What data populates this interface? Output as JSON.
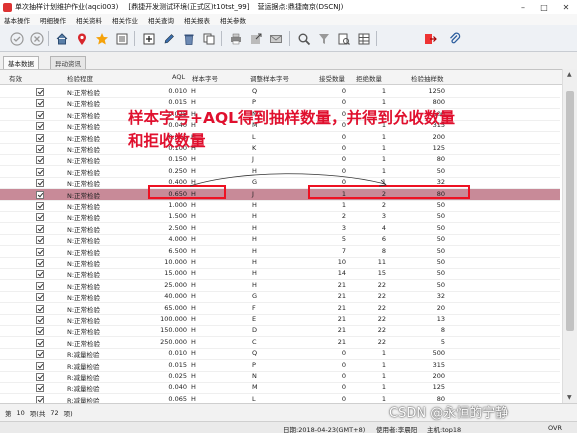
{
  "window": {
    "title": "单次抽样计划维护作业(aqci003)",
    "env": "[鼎捷开发测试环境(正式区)t10tst_99]",
    "site": "营运据点:鼎捷南京(DSCNJ)"
  },
  "menu": [
    "基本操作",
    "明细操作",
    "相关资料",
    "相关作业",
    "相关查询",
    "相关报表",
    "相关参数"
  ],
  "toolbar": {
    "icons": [
      "confirm-icon",
      "cancel-icon",
      "home-icon",
      "location-pin-icon",
      "star-icon",
      "list-icon",
      "add-icon",
      "edit-icon",
      "delete-icon",
      "copy-icon",
      "print-icon",
      "export-icon",
      "mail-icon",
      "search-icon",
      "filter-icon",
      "query-icon",
      "table-icon",
      "exit-icon",
      "attach-icon"
    ]
  },
  "tabs": [
    "基本数据",
    "异动资讯"
  ],
  "columns": {
    "valid": "有效",
    "level": "检验程度",
    "aql": "AQL",
    "sample_code": "样本字号",
    "adj_code": "调整样本字号",
    "accept": "接受数量",
    "reject": "拒绝数量",
    "sample_qty": "检验抽样数"
  },
  "rows": [
    {
      "level": "N:正常检验",
      "aql": "0.010",
      "c": "H",
      "adj": "Q",
      "acc": "0",
      "rej": "1",
      "qty": "1250"
    },
    {
      "level": "N:正常检验",
      "aql": "0.015",
      "c": "H",
      "adj": "P",
      "acc": "0",
      "rej": "1",
      "qty": "800"
    },
    {
      "level": "N:正常检验",
      "aql": "0.025",
      "c": "H",
      "adj": "N",
      "acc": "0",
      "rej": "1",
      "qty": "500"
    },
    {
      "level": "N:正常检验",
      "aql": "0.040",
      "c": "H",
      "adj": "M",
      "acc": "0",
      "rej": "1",
      "qty": "315"
    },
    {
      "level": "N:正常检验",
      "aql": "0.065",
      "c": "H",
      "adj": "L",
      "acc": "0",
      "rej": "1",
      "qty": "200"
    },
    {
      "level": "N:正常检验",
      "aql": "0.100",
      "c": "H",
      "adj": "K",
      "acc": "0",
      "rej": "1",
      "qty": "125"
    },
    {
      "level": "N:正常检验",
      "aql": "0.150",
      "c": "H",
      "adj": "J",
      "acc": "0",
      "rej": "1",
      "qty": "80"
    },
    {
      "level": "N:正常检验",
      "aql": "0.250",
      "c": "H",
      "adj": "H",
      "acc": "0",
      "rej": "1",
      "qty": "50"
    },
    {
      "level": "N:正常检验",
      "aql": "0.400",
      "c": "H",
      "adj": "G",
      "acc": "0",
      "rej": "1",
      "qty": "32"
    },
    {
      "level": "N:正常检验",
      "aql": "0.650",
      "c": "H",
      "adj": "J",
      "acc": "1",
      "rej": "2",
      "qty": "80"
    },
    {
      "level": "N:正常检验",
      "aql": "1.000",
      "c": "H",
      "adj": "H",
      "acc": "1",
      "rej": "2",
      "qty": "50"
    },
    {
      "level": "N:正常检验",
      "aql": "1.500",
      "c": "H",
      "adj": "H",
      "acc": "2",
      "rej": "3",
      "qty": "50"
    },
    {
      "level": "N:正常检验",
      "aql": "2.500",
      "c": "H",
      "adj": "H",
      "acc": "3",
      "rej": "4",
      "qty": "50"
    },
    {
      "level": "N:正常检验",
      "aql": "4.000",
      "c": "H",
      "adj": "H",
      "acc": "5",
      "rej": "6",
      "qty": "50"
    },
    {
      "level": "N:正常检验",
      "aql": "6.500",
      "c": "H",
      "adj": "H",
      "acc": "7",
      "rej": "8",
      "qty": "50"
    },
    {
      "level": "N:正常检验",
      "aql": "10.000",
      "c": "H",
      "adj": "H",
      "acc": "10",
      "rej": "11",
      "qty": "50"
    },
    {
      "level": "N:正常检验",
      "aql": "15.000",
      "c": "H",
      "adj": "H",
      "acc": "14",
      "rej": "15",
      "qty": "50"
    },
    {
      "level": "N:正常检验",
      "aql": "25.000",
      "c": "H",
      "adj": "H",
      "acc": "21",
      "rej": "22",
      "qty": "50"
    },
    {
      "level": "N:正常检验",
      "aql": "40.000",
      "c": "H",
      "adj": "G",
      "acc": "21",
      "rej": "22",
      "qty": "32"
    },
    {
      "level": "N:正常检验",
      "aql": "65.000",
      "c": "H",
      "adj": "F",
      "acc": "21",
      "rej": "22",
      "qty": "20"
    },
    {
      "level": "N:正常检验",
      "aql": "100.000",
      "c": "H",
      "adj": "E",
      "acc": "21",
      "rej": "22",
      "qty": "13"
    },
    {
      "level": "N:正常检验",
      "aql": "150.000",
      "c": "H",
      "adj": "D",
      "acc": "21",
      "rej": "22",
      "qty": "8"
    },
    {
      "level": "N:正常检验",
      "aql": "250.000",
      "c": "H",
      "adj": "C",
      "acc": "21",
      "rej": "22",
      "qty": "5"
    },
    {
      "level": "R:减量检验",
      "aql": "0.010",
      "c": "H",
      "adj": "Q",
      "acc": "0",
      "rej": "1",
      "qty": "500"
    },
    {
      "level": "R:减量检验",
      "aql": "0.015",
      "c": "H",
      "adj": "P",
      "acc": "0",
      "rej": "1",
      "qty": "315"
    },
    {
      "level": "R:减量检验",
      "aql": "0.025",
      "c": "H",
      "adj": "N",
      "acc": "0",
      "rej": "1",
      "qty": "200"
    },
    {
      "level": "R:减量检验",
      "aql": "0.040",
      "c": "H",
      "adj": "M",
      "acc": "0",
      "rej": "1",
      "qty": "125"
    },
    {
      "level": "R:减量检验",
      "aql": "0.065",
      "c": "H",
      "adj": "L",
      "acc": "0",
      "rej": "1",
      "qty": "80"
    }
  ],
  "annotation": {
    "line1": "样本字号+AQL得到抽样数量，并得到允收数量",
    "line2": "和拒收数量"
  },
  "pager": {
    "prefix": "第",
    "current": "10",
    "item_of": "项(共",
    "total": "72",
    "suffix": "项)"
  },
  "status": {
    "date": "日期:2018-04-23(GMT+8)",
    "user": "使用者:李晨阳",
    "host": "主机:top18",
    "mode": "OVR"
  },
  "watermark": "CSDN @永恒的宁静"
}
